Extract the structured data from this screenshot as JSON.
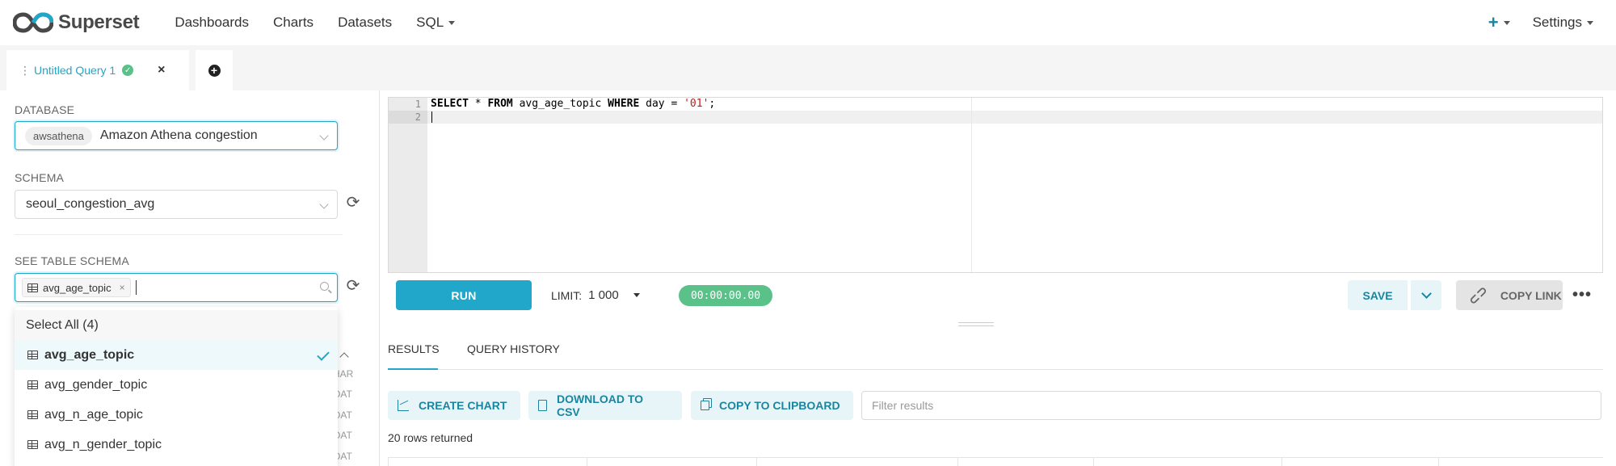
{
  "nav": {
    "brand": "Superset",
    "items": [
      "Dashboards",
      "Charts",
      "Datasets",
      "SQL"
    ],
    "settings_label": "Settings",
    "plus_label": "+"
  },
  "query_tab": {
    "title": "Untitled Query 1",
    "status": "success",
    "close": "×",
    "add": "+"
  },
  "left": {
    "database_label": "DATABASE",
    "database_backend": "awsathena",
    "database_name": "Amazon Athena congestion",
    "schema_label": "SCHEMA",
    "schema_value": "seoul_congestion_avg",
    "table_schema_label": "SEE TABLE SCHEMA",
    "selected_table": "avg_age_topic",
    "tag_remove": "×",
    "dropdown": {
      "select_all": "Select All (4)",
      "options": [
        "avg_age_topic",
        "avg_gender_topic",
        "avg_n_age_topic",
        "avg_n_gender_topic"
      ],
      "selected_index": 0
    },
    "background_types": [
      "HAR",
      "OAT",
      "OAT",
      "OAT",
      "OAT"
    ]
  },
  "editor": {
    "line_numbers": [
      "1",
      "2"
    ],
    "code": {
      "kw1": "SELECT",
      "t1": " * ",
      "kw2": "FROM",
      "t2": " avg_age_topic ",
      "kw3": "WHERE",
      "t3": " day = ",
      "str": "'01'",
      "t4": ";"
    }
  },
  "toolbar": {
    "run_label": "RUN",
    "limit_label": "LIMIT:",
    "limit_value": "1 000",
    "timer": "00:00:00.00",
    "save_label": "SAVE",
    "copy_link_label": "COPY LINK",
    "more": "•••"
  },
  "results": {
    "tabs": [
      "RESULTS",
      "QUERY HISTORY"
    ],
    "actions": [
      "CREATE CHART",
      "DOWNLOAD TO CSV",
      "COPY TO CLIPBOARD"
    ],
    "filter_placeholder": "Filter results",
    "rows_returned": "20 rows returned"
  },
  "colors": {
    "accent": "#20a7c9",
    "success": "#5ac189",
    "string_literal": "#c41a16"
  }
}
